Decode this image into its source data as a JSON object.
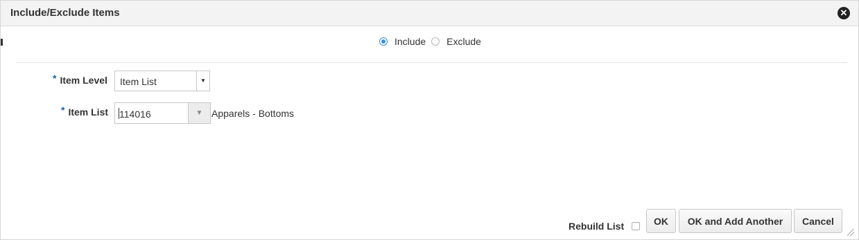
{
  "dialog": {
    "title": "Include/Exclude Items",
    "close_icon": "close-circle-icon"
  },
  "mode": {
    "options": [
      "Include",
      "Exclude"
    ],
    "selected": "Include"
  },
  "fields": {
    "item_level": {
      "label": "Item Level",
      "required_marker": "*",
      "value": "Item List"
    },
    "item_list": {
      "label": "Item List",
      "required_marker": "*",
      "value": "114016",
      "description": "Apparels - Bottoms"
    }
  },
  "footer": {
    "rebuild_label": "Rebuild List",
    "rebuild_checked": false,
    "ok_label": "OK",
    "ok_add_label": "OK and Add Another",
    "cancel_label": "Cancel"
  },
  "colors": {
    "accent": "#3d8ee0",
    "required": "#1f5fa8",
    "titlebar": "#f3f3f3"
  }
}
